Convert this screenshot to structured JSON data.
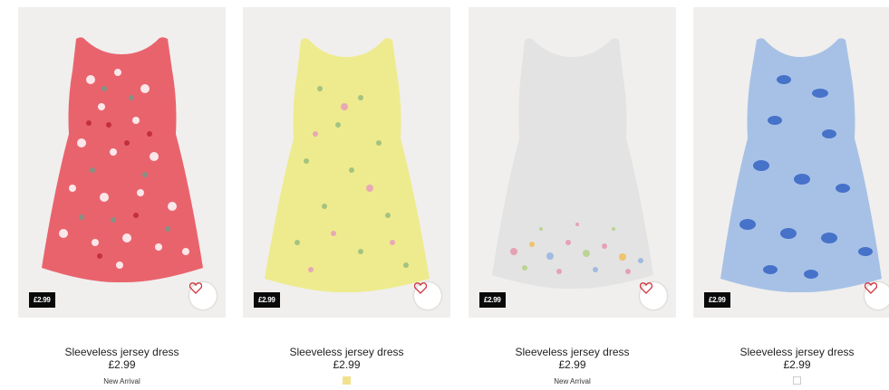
{
  "products": [
    {
      "title": "Sleeveless jersey dress",
      "price": "£2.99",
      "price_tag": "£2.99",
      "note": "New Arrival",
      "swatch_color": null,
      "pattern": "red floral",
      "colors": {
        "dress": "#e9636d",
        "accent": "#ffffff"
      }
    },
    {
      "title": "Sleeveless jersey dress",
      "price": "£2.99",
      "price_tag": "£2.99",
      "note": "",
      "swatch_color": "#f2e28e",
      "pattern": "yellow floral",
      "colors": {
        "dress": "#eeeb8e",
        "accent": "#9bbf7f"
      }
    },
    {
      "title": "Sleeveless jersey dress",
      "price": "£2.99",
      "price_tag": "£2.99",
      "note": "New Arrival",
      "swatch_color": null,
      "pattern": "grey with floral hem",
      "colors": {
        "dress": "#e3e3e3",
        "accent": "#e79ab0"
      }
    },
    {
      "title": "Sleeveless jersey dress",
      "price": "£2.99",
      "price_tag": "£2.99",
      "note": "",
      "swatch_color": "#ffffff",
      "pattern": "blue butterflies",
      "colors": {
        "dress": "#a7c1e6",
        "accent": "#2f5fc3"
      }
    }
  ],
  "icons": {
    "favorite": "heart-outline-icon"
  },
  "accent_color": "#d2323c"
}
